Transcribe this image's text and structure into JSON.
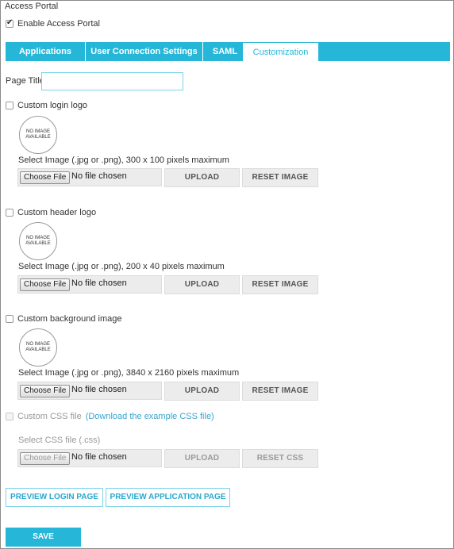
{
  "section_title": "Access Portal",
  "enable_label": "Enable Access Portal",
  "tabs": [
    {
      "label": "Applications"
    },
    {
      "label": "User Connection Settings"
    },
    {
      "label": "SAML"
    },
    {
      "label": "Customization"
    }
  ],
  "page_title_label": "Page Title",
  "page_title_value": "",
  "no_image_text": "NO IMAGE AVAILABLE",
  "choose_file_label": "Choose File",
  "no_file_text": "No file chosen",
  "upload_label": "UPLOAD",
  "reset_image_label": "RESET IMAGE",
  "login_logo": {
    "checkbox_label": "Custom login logo",
    "hint": "Select Image (.jpg or .png), 300 x 100 pixels maximum"
  },
  "header_logo": {
    "checkbox_label": "Custom header logo",
    "hint": "Select Image (.jpg or .png), 200 x 40 pixels maximum"
  },
  "background_image": {
    "checkbox_label": "Custom background image",
    "hint": "Select Image (.jpg or .png), 3840 x 2160 pixels maximum"
  },
  "css_file": {
    "checkbox_label": "Custom CSS file",
    "link_text": "(Download the example CSS file)",
    "hint": "Select CSS file (.css)",
    "reset_label": "RESET CSS"
  },
  "preview_login_label": "PREVIEW LOGIN PAGE",
  "preview_app_label": "PREVIEW APPLICATION PAGE",
  "save_label": "SAVE",
  "colors": {
    "accent": "#26b7d8",
    "outline": "#7fd3e8"
  }
}
